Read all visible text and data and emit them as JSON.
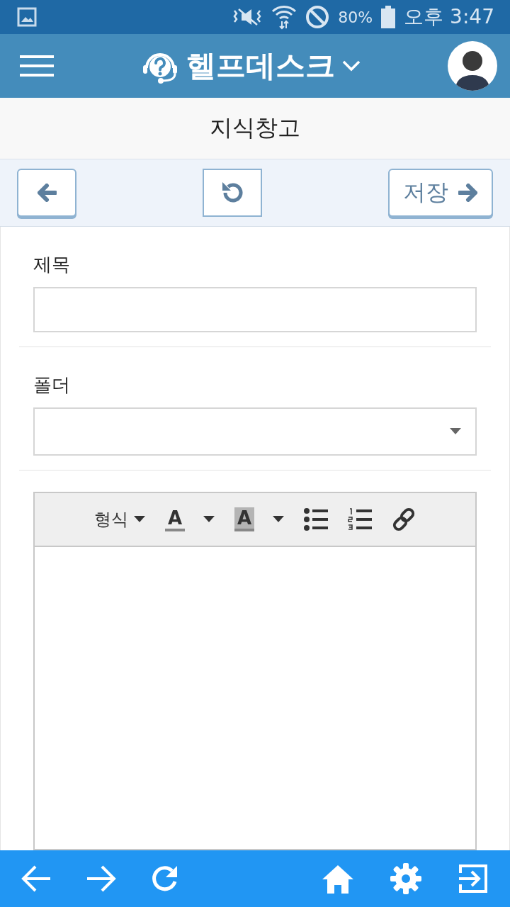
{
  "status_bar": {
    "battery": "80%",
    "time": "오후 3:47"
  },
  "header": {
    "title": "헬프데스크"
  },
  "page": {
    "title": "지식창고"
  },
  "actions": {
    "save": "저장"
  },
  "form": {
    "fields": [
      {
        "kind": "text",
        "label": "제목"
      },
      {
        "kind": "select",
        "label": "폴더"
      }
    ]
  },
  "editor": {
    "format": "형식",
    "text_color": "A",
    "highlight": "A"
  }
}
